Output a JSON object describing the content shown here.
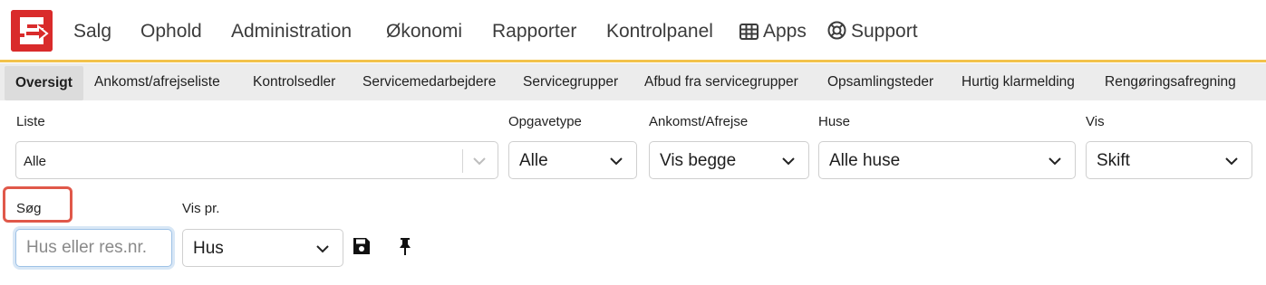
{
  "brand": {
    "logo_icon": "logo-icon",
    "color": "#d92b2b"
  },
  "nav": {
    "items": [
      {
        "label": "Salg"
      },
      {
        "label": "Ophold"
      },
      {
        "label": "Administration"
      },
      {
        "label": "Økonomi"
      },
      {
        "label": "Rapporter"
      },
      {
        "label": "Kontrolpanel"
      },
      {
        "label": "Apps",
        "icon": "grid-icon"
      },
      {
        "label": "Support",
        "icon": "lifebuoy-icon"
      }
    ]
  },
  "tabs": [
    {
      "label": "Oversigt",
      "active": true
    },
    {
      "label": "Ankomst/afrejseliste"
    },
    {
      "label": "Kontrolsedler"
    },
    {
      "label": "Servicemedarbejdere"
    },
    {
      "label": "Servicegrupper"
    },
    {
      "label": "Afbud fra servicegrupper"
    },
    {
      "label": "Opsamlingsteder"
    },
    {
      "label": "Hurtig klarmelding"
    },
    {
      "label": "Rengøringsafregning"
    }
  ],
  "filters": {
    "liste": {
      "label": "Liste",
      "value": "Alle"
    },
    "opgavetype": {
      "label": "Opgavetype",
      "value": "Alle"
    },
    "ankomst": {
      "label": "Ankomst/Afrejse",
      "value": "Vis begge"
    },
    "huse": {
      "label": "Huse",
      "value": "Alle huse"
    },
    "vis": {
      "label": "Vis",
      "value": "Skift"
    }
  },
  "search": {
    "label": "Søg",
    "placeholder": "Hus eller res.nr.",
    "value": ""
  },
  "vispr": {
    "label": "Vis pr.",
    "value": "Hus"
  },
  "actions": {
    "save_icon": "save-icon",
    "pin_icon": "pin-icon"
  },
  "colors": {
    "accent_line": "#f2c24b",
    "highlight": "#e0584a",
    "focus": "#9ec2e6"
  }
}
